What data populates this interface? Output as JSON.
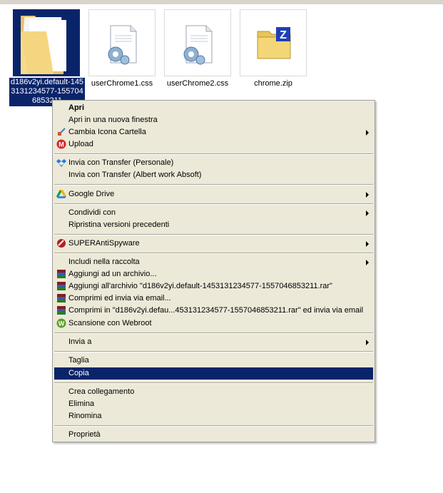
{
  "files": [
    {
      "name": "d186v2yi.default-1453131234577-1557046853211",
      "type": "folder",
      "selected": true
    },
    {
      "name": "userChrome1.css",
      "type": "css"
    },
    {
      "name": "userChrome2.css",
      "type": "css"
    },
    {
      "name": "chrome.zip",
      "type": "zip"
    }
  ],
  "menu": {
    "open": "Apri",
    "open_new_window": "Apri in una nuova finestra",
    "change_folder_icon": "Cambia Icona Cartella",
    "upload": "Upload",
    "transfer_personal": "Invia con Transfer (Personale)",
    "transfer_work": "Invia con Transfer (Albert work Absoft)",
    "google_drive": "Google Drive",
    "share_with": "Condividi con",
    "restore_previous": "Ripristina versioni precedenti",
    "superantispyware": "SUPERAntiSpyware",
    "include_in_library": "Includi nella raccolta",
    "add_to_archive": "Aggiungi ad un archivio...",
    "add_to_rar": "Aggiungi all'archivio \"d186v2yi.default-1453131234577-1557046853211.rar\"",
    "compress_email": "Comprimi ed invia via email...",
    "compress_rar_email": "Comprimi in \"d186v2yi.defau...453131234577-1557046853211.rar\" ed invia via email",
    "webroot_scan": "Scansione con Webroot",
    "send_to": "Invia a",
    "cut": "Taglia",
    "copy": "Copia",
    "create_shortcut": "Crea collegamento",
    "delete": "Elimina",
    "rename": "Rinomina",
    "properties": "Proprietà"
  },
  "colors": {
    "selection": "#0a246a",
    "menu_bg": "#ece9d8"
  }
}
